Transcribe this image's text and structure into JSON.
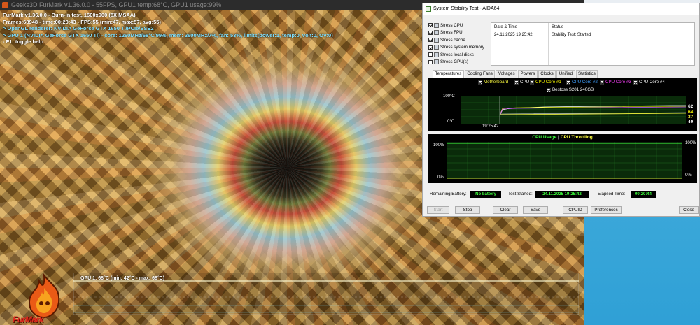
{
  "furmark": {
    "titlebar": "Geeks3D FurMark v1.36.0.0 - 55FPS, GPU1 temp:68°C, GPU1 usage:99%",
    "info": {
      "line1": "FurMark v1.36.0.0 - Burn-in test, 1600x900 (8X MSAA)",
      "line2": "Frames:68948 - time:00:20:43 - FPS:55 (min:47, max:57, avg:55)",
      "line3": "> OpenGL renderer: NVIDIA GeForce GTX 1650 Ti/PCIe/SSE2",
      "line4": "> GPU 1 (NVIDIA GeForce GTX 1650 Ti) - core: 1260MHz/68°C/99%, mem: 3600MHz/7%, fan: 53%, limits(power:1, temp:0, volt:0, OV:0)",
      "line5": "- F1: toggle help"
    },
    "gpu_graph_label": "GPU 1: 68°C (min: 42°C - max: 68°C)",
    "logo_text": "FurMark"
  },
  "aida": {
    "window_title": "System Stability Test - AIDA64",
    "stress_items": [
      {
        "label": "Stress CPU",
        "checked": true
      },
      {
        "label": "Stress FPU",
        "checked": true
      },
      {
        "label": "Stress cache",
        "checked": true
      },
      {
        "label": "Stress system memory",
        "checked": true
      },
      {
        "label": "Stress local disks",
        "checked": false
      },
      {
        "label": "Stress GPU(s)",
        "checked": false
      }
    ],
    "status_table": {
      "col_datetime": "Date & Time",
      "col_status": "Status",
      "datetime_value": "24.11.2025 19:25:42",
      "status_value": "Stability Test: Started"
    },
    "tabs": [
      "Temperatures",
      "Cooling Fans",
      "Voltages",
      "Powers",
      "Clocks",
      "Unified",
      "Statistics"
    ],
    "temp_legend": {
      "motherboard": "Motherboard",
      "cpu": "CPU",
      "core1": "CPU Core #1",
      "core2": "CPU Core #2",
      "core3": "CPU Core #3",
      "core4": "CPU Core #4",
      "ssd": "Bestoss S201 240GB"
    },
    "temp_axis": {
      "top": "100°C",
      "bottom": "0°C",
      "time": "19:25:42"
    },
    "temp_readings": {
      "r1": "62",
      "r2": "64",
      "r3": "37",
      "r4": "40"
    },
    "cpu_legend": {
      "usage": "CPU Usage",
      "sep": "|",
      "throttling": "CPU Throttling"
    },
    "cpu_axis": {
      "top_left": "100%",
      "bottom_left": "0%",
      "top_right": "100%",
      "bottom_right": "0%"
    },
    "bottom": {
      "battery_label": "Remaining Battery:",
      "battery_value": "No battery",
      "started_label": "Test Started:",
      "started_value": "24.11.2025 19:25:42",
      "elapsed_label": "Elapsed Time:",
      "elapsed_value": "00:20:44"
    },
    "buttons": {
      "start": "Start",
      "stop": "Stop",
      "clear": "Clear",
      "save": "Save",
      "cpuid": "CPUID",
      "preferences": "Preferences",
      "close": "Close"
    },
    "colors": {
      "motherboard": "#ffff40",
      "cpu": "#40ff40",
      "core1": "#ffff00",
      "core2": "#40a0ff",
      "core3": "#ff40ff",
      "core4": "#ffffff",
      "ssd": "#ffffff",
      "graph_green": "#2fbf2f",
      "panel_bg": "#000000"
    }
  }
}
